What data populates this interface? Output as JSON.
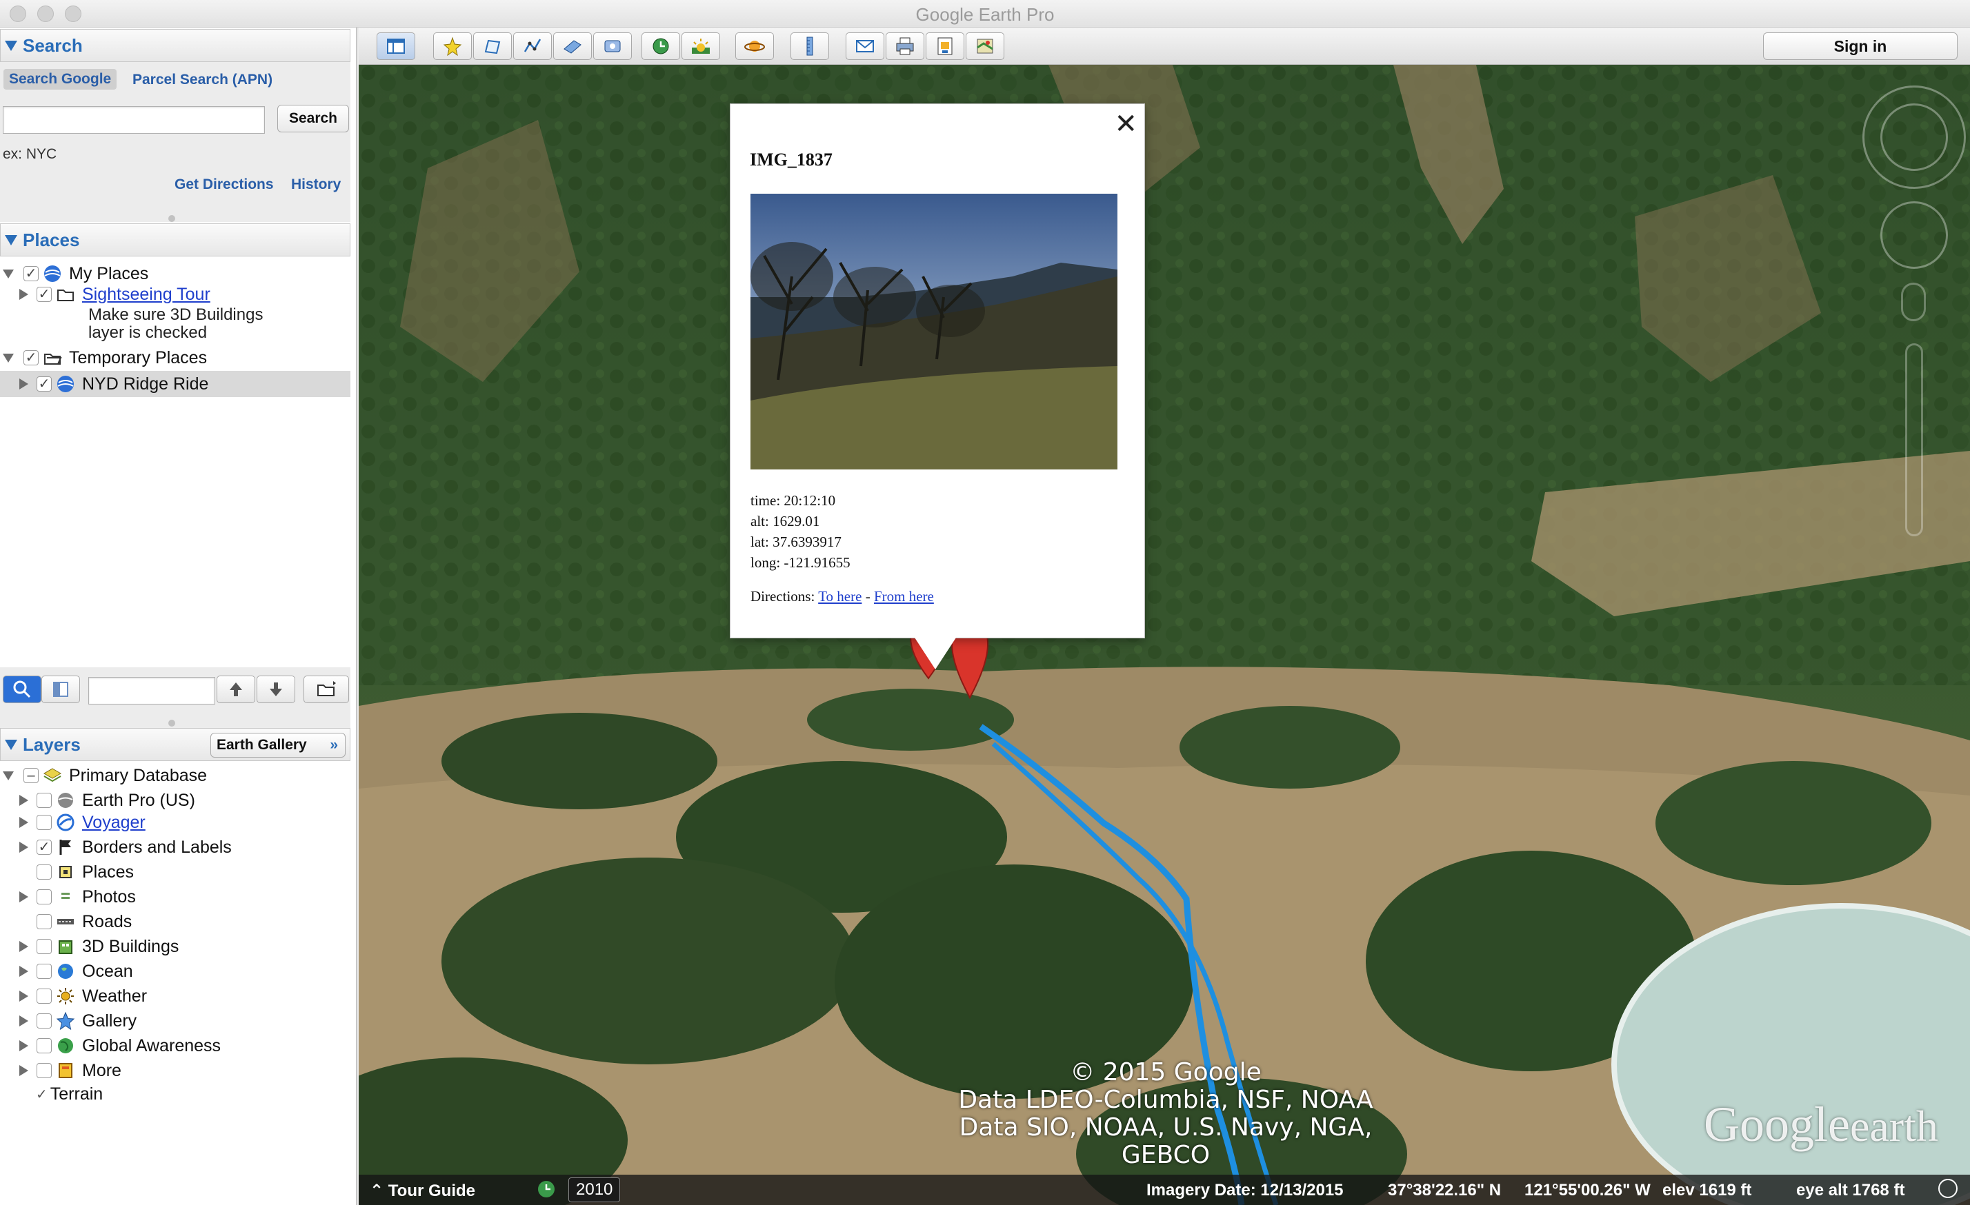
{
  "app": {
    "title": "Google Earth Pro"
  },
  "search": {
    "title": "Search",
    "tabs": [
      "Search Google",
      "Parcel Search (APN)"
    ],
    "input_value": "",
    "button": "Search",
    "hint": "ex: NYC",
    "get_directions": "Get Directions",
    "history": "History"
  },
  "places": {
    "title": "Places",
    "my_places": "My Places",
    "sightseeing": "Sightseeing Tour",
    "sightseeing_note_1": "Make sure 3D Buildings",
    "sightseeing_note_2": "layer is checked",
    "temporary": "Temporary Places",
    "ride": "NYD Ridge Ride",
    "search_field": ""
  },
  "layers": {
    "title": "Layers",
    "earth_gallery": "Earth Gallery",
    "items": [
      "Primary Database",
      "Earth Pro (US)",
      "Voyager",
      "Borders and Labels",
      "Places",
      "Photos",
      "Roads",
      "3D Buildings",
      "Ocean",
      "Weather",
      "Gallery",
      "Global Awareness",
      "More",
      "Terrain"
    ]
  },
  "toolbar": {
    "sign_in": "Sign in"
  },
  "balloon": {
    "title": "IMG_1837",
    "time": "time: 20:12:10",
    "alt": "alt: 1629.01",
    "lat": "lat: 37.6393917",
    "long": "long: -121.91655",
    "directions_label": "Directions:",
    "to_here": "To here",
    "separator": "-",
    "from_here": "From here",
    "close": "✕"
  },
  "attribution": {
    "line1": "© 2015 Google",
    "line2": "Data LDEO-Columbia, NSF, NOAA",
    "line3": "Data SIO, NOAA, U.S. Navy, NGA, GEBCO"
  },
  "logo": {
    "google": "Google",
    "earth": "earth"
  },
  "status": {
    "tour_guide": "Tour Guide",
    "year": "2010",
    "imagery_date": "Imagery Date: 12/13/2015",
    "lat": "37°38'22.16\" N",
    "lon": "121°55'00.26\" W",
    "elev": "elev  1619 ft",
    "eye_alt": "eye alt  1768 ft"
  },
  "colors": {
    "accent": "#2a6db8",
    "track": "#1e8fe0",
    "pin": "#d9342b"
  }
}
